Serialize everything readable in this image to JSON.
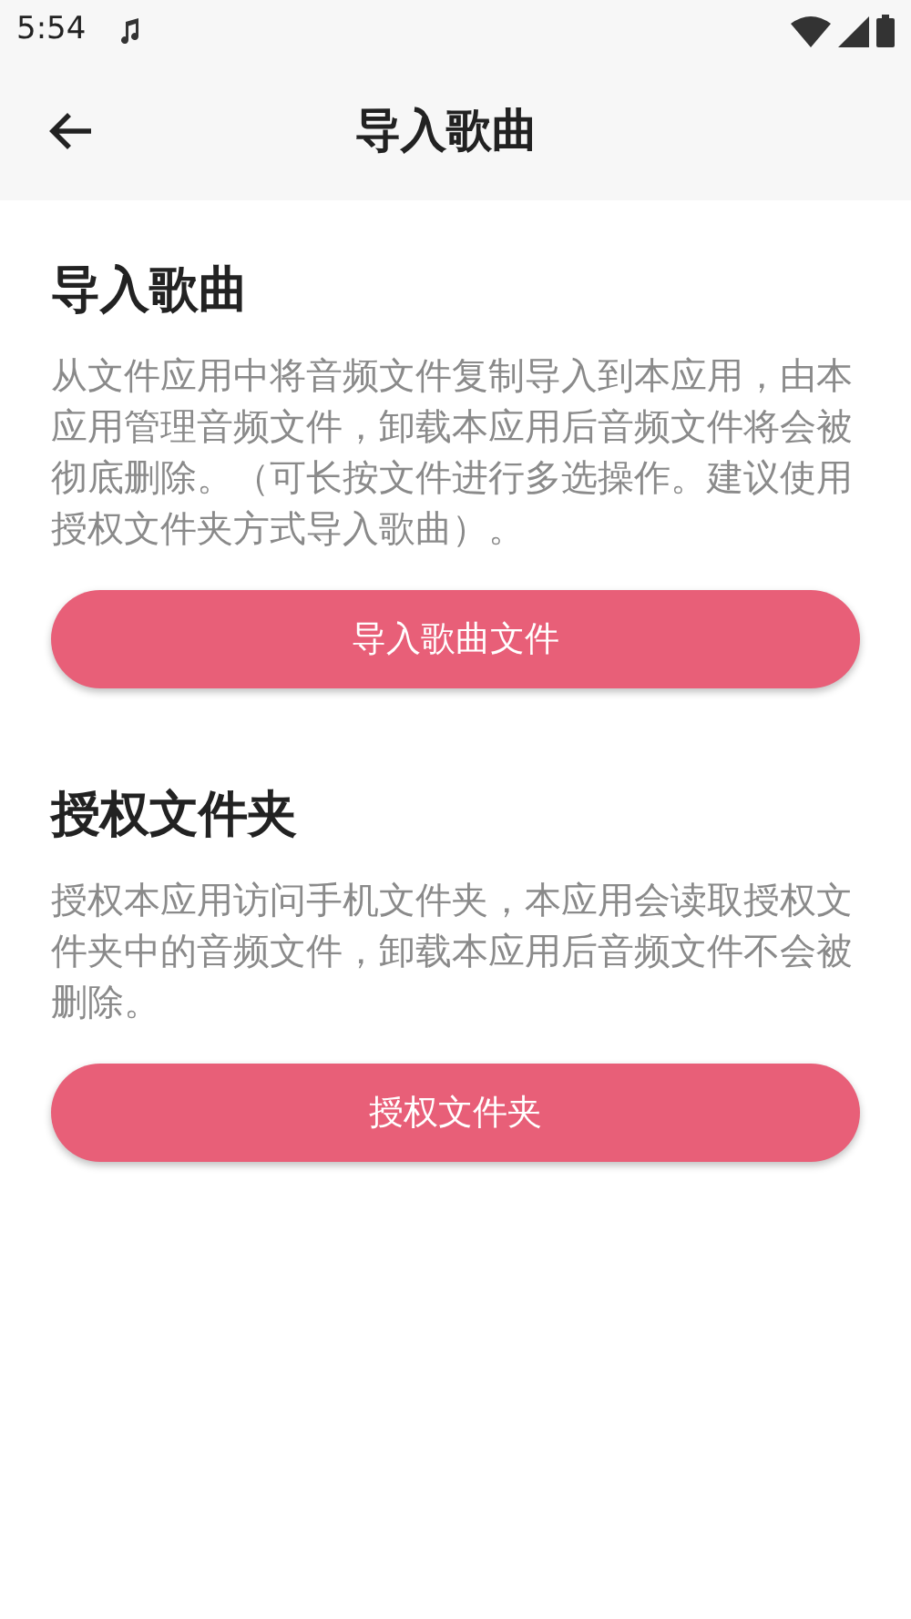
{
  "status_bar": {
    "time": "5:54"
  },
  "app_bar": {
    "title": "导入歌曲"
  },
  "sections": [
    {
      "title": "导入歌曲",
      "description": "从文件应用中将音频文件复制导入到本应用，由本应用管理音频文件，卸载本应用后音频文件将会被彻底删除。（可长按文件进行多选操作。建议使用授权文件夹方式导入歌曲）。",
      "button": "导入歌曲文件"
    },
    {
      "title": "授权文件夹",
      "description": "授权本应用访问手机文件夹，本应用会读取授权文件夹中的音频文件，卸载本应用后音频文件不会被删除。",
      "button": "授权文件夹"
    }
  ]
}
